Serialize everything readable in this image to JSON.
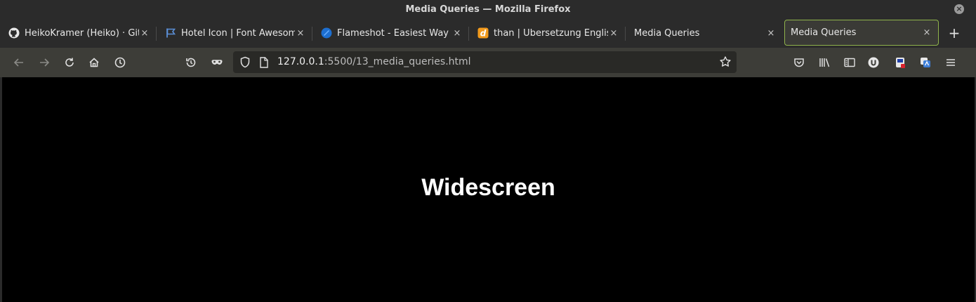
{
  "window": {
    "title": "Media Queries — Mozilla Firefox",
    "close_glyph": "×"
  },
  "tabs": [
    {
      "label": "HeikoKramer (Heiko) · GitHub",
      "icon": "github-icon",
      "close": "×",
      "active": false
    },
    {
      "label": "Hotel Icon | Font Awesome",
      "icon": "flag-icon",
      "close": "×",
      "active": false
    },
    {
      "label": "Flameshot - Easiest Way to take screenshots",
      "icon": "flameshot-icon",
      "close": "×",
      "active": false
    },
    {
      "label": "than | Übersetzung Englisch-Deutsch",
      "icon": "dict-icon",
      "close": "×",
      "active": false
    },
    {
      "label": "Media Queries",
      "icon": "none",
      "close": "×",
      "active": false
    },
    {
      "label": "Media Queries",
      "icon": "none",
      "close": "×",
      "active": true
    }
  ],
  "new_tab": "+",
  "toolbar": {
    "url_host": "127.0.0.1",
    "url_rest": ":5500/13_media_queries.html"
  },
  "content": {
    "heading": "Widescreen"
  },
  "colors": {
    "chrome": "#2b2b2b",
    "toolbar": "#3d3d38",
    "active_tab_border": "#8fb34b",
    "page_background": "#000000",
    "heading": "#ffffff"
  }
}
